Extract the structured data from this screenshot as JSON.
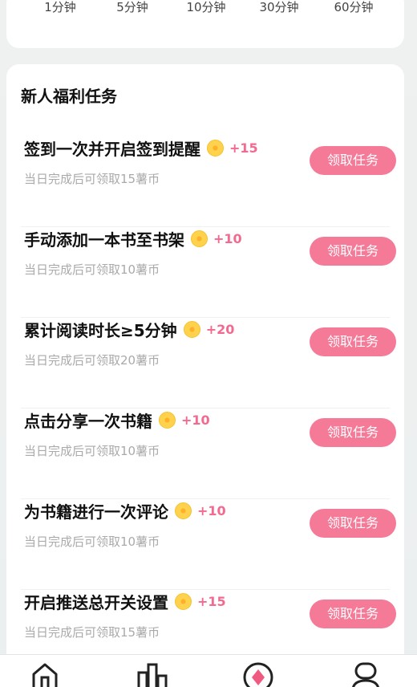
{
  "time_options": [
    "1分钟",
    "5分钟",
    "10分钟",
    "30分钟",
    "60分钟"
  ],
  "tasks_section": {
    "title": "新人福利任务",
    "button_label": "领取任务",
    "tasks": [
      {
        "title": "签到一次并开启签到提醒",
        "reward": "+15",
        "desc": "当日完成后可领取15薯币"
      },
      {
        "title": "手动添加一本书至书架",
        "reward": "+10",
        "desc": "当日完成后可领取10薯币"
      },
      {
        "title": "累计阅读时长≥5分钟",
        "reward": "+20",
        "desc": "当日完成后可领取20薯币"
      },
      {
        "title": "点击分享一次书籍",
        "reward": "+10",
        "desc": "当日完成后可领取10薯币"
      },
      {
        "title": "为书籍进行一次评论",
        "reward": "+10",
        "desc": "当日完成后可领取10薯币"
      },
      {
        "title": "开启推送总开关设置",
        "reward": "+15",
        "desc": "当日完成后可领取15薯币"
      }
    ]
  },
  "tabbar": {
    "icons": [
      "home-icon",
      "ranking-icon",
      "welfare-icon",
      "profile-icon"
    ]
  },
  "colors": {
    "accent": "#f57a98",
    "reward": "#f26a8f",
    "coin": "#ffd24d"
  }
}
